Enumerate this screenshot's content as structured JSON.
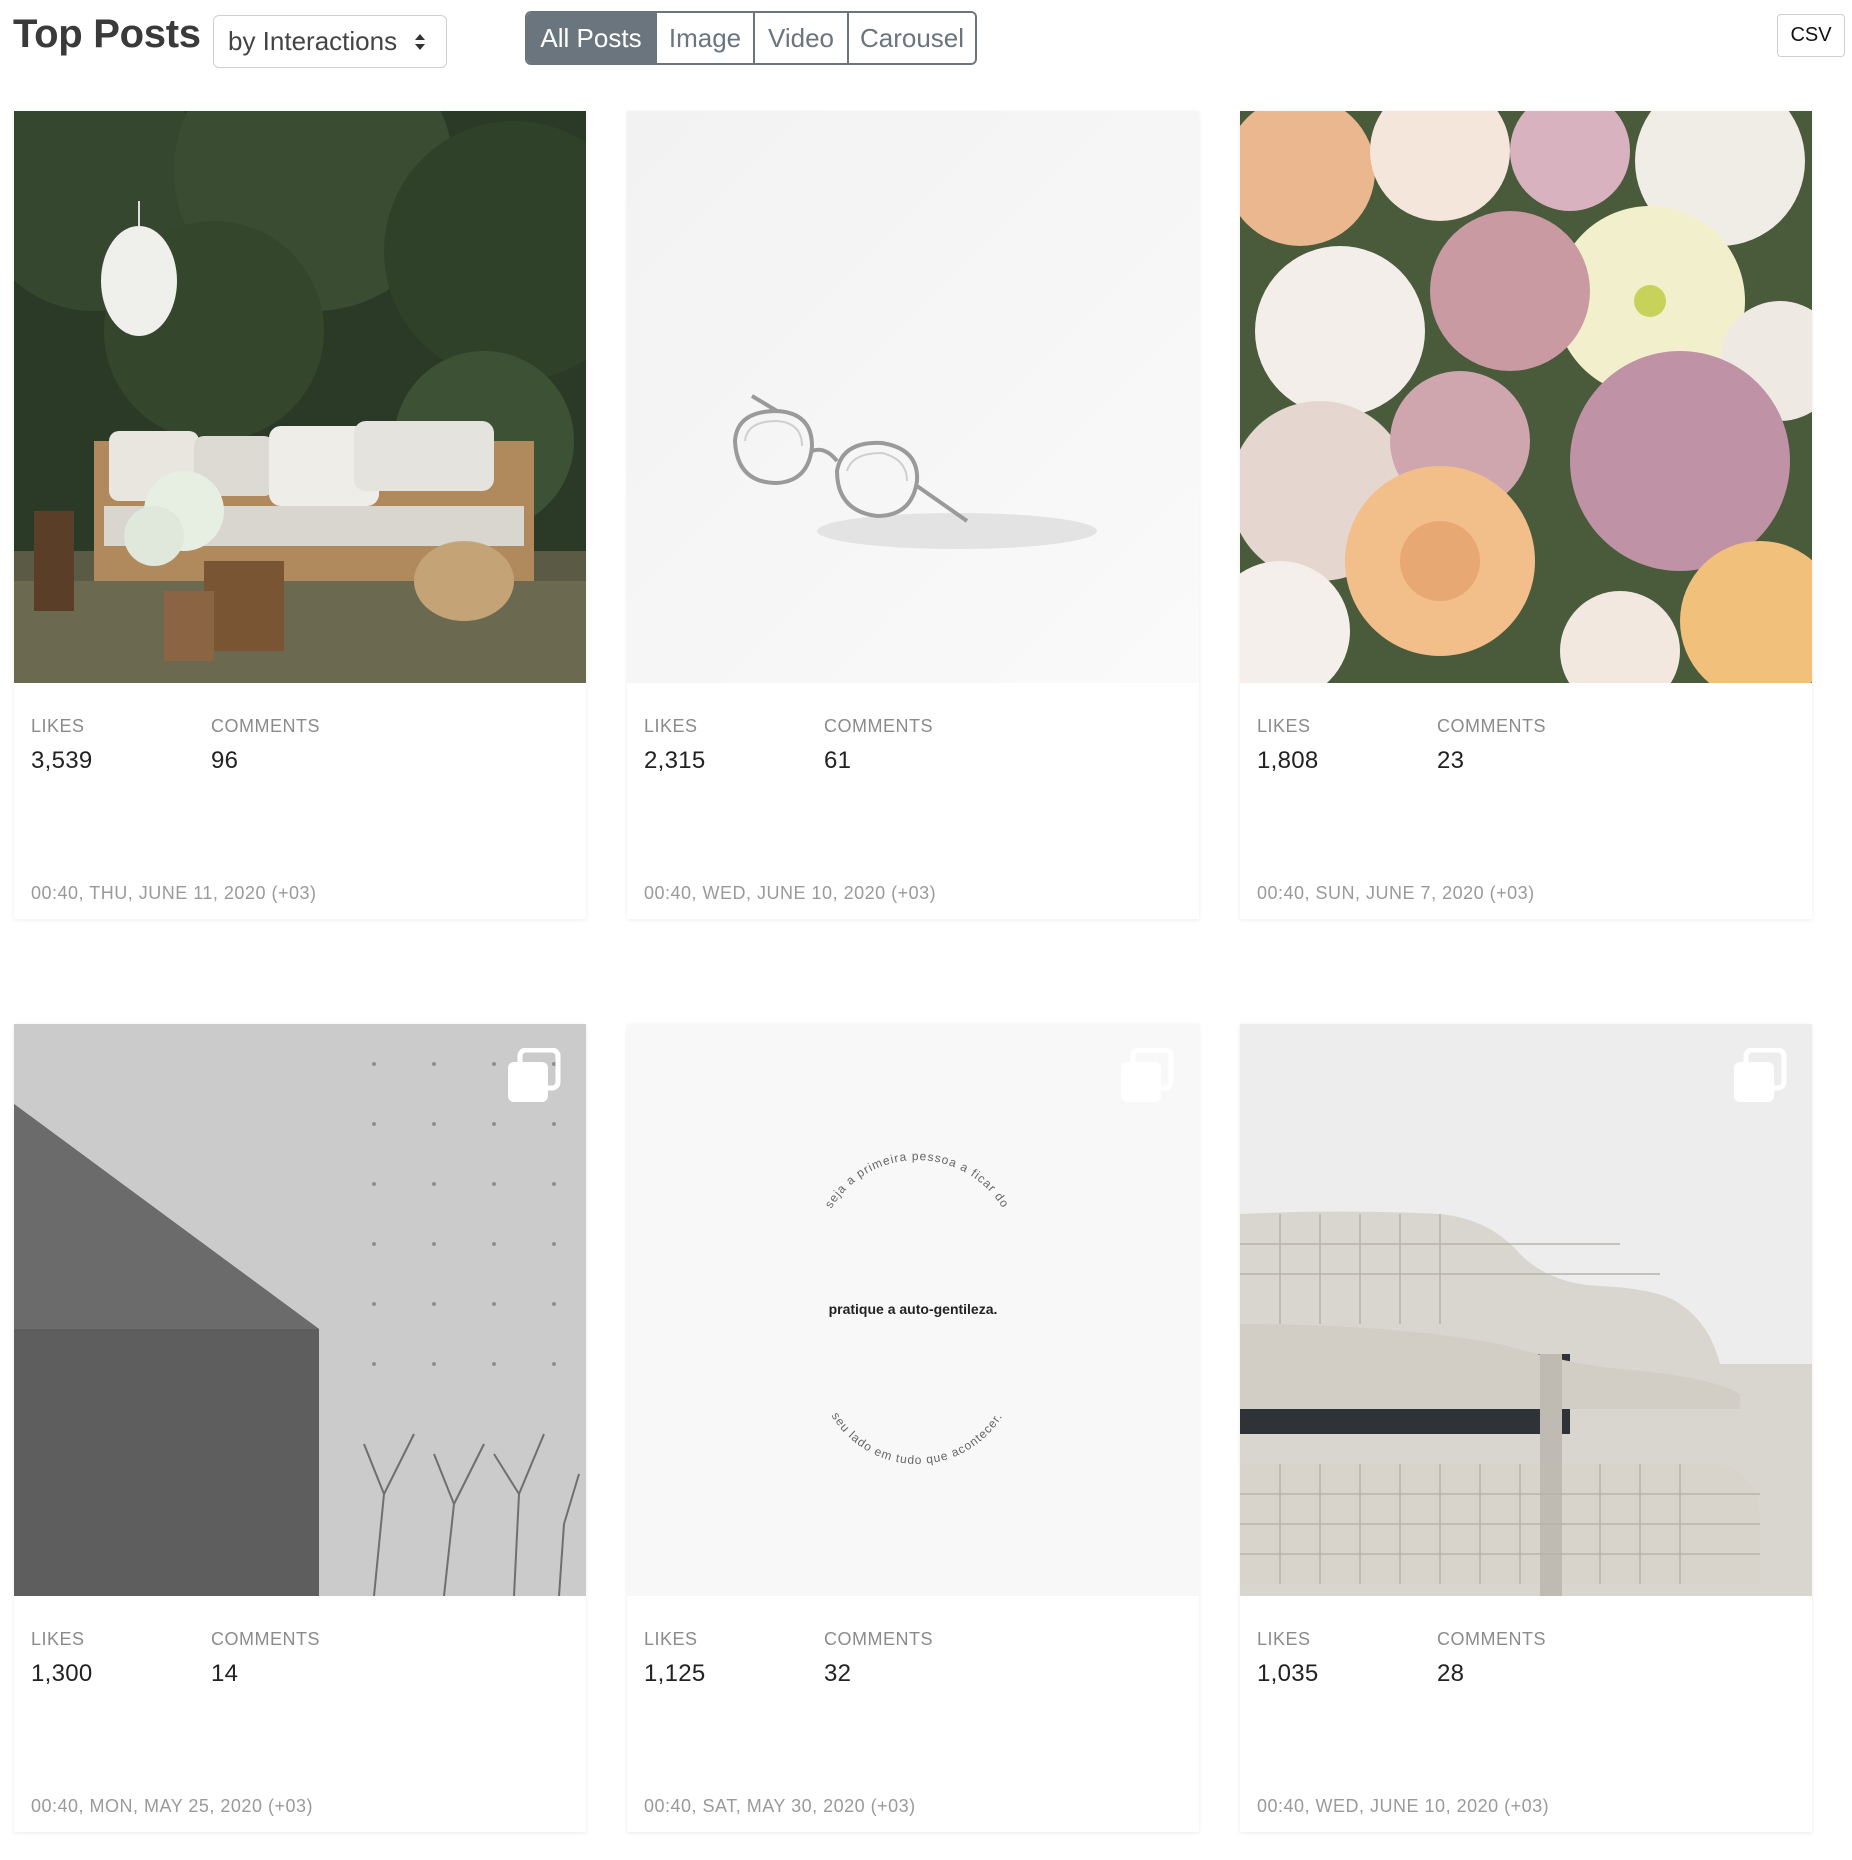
{
  "header": {
    "title": "Top Posts",
    "sort_value": "by Interactions",
    "filters": [
      "All Posts",
      "Image",
      "Video",
      "Carousel"
    ],
    "active_filter": "All Posts",
    "csv_label": "CSV"
  },
  "labels": {
    "likes": "LIKES",
    "comments": "COMMENTS"
  },
  "posts": [
    {
      "likes": "3,539",
      "comments": "96",
      "timestamp": "00:40, THU, JUNE 11, 2020 (+03)",
      "carousel": false,
      "image": "garden-bench-photo"
    },
    {
      "likes": "2,315",
      "comments": "61",
      "timestamp": "00:40, WED, JUNE 10, 2020 (+03)",
      "carousel": false,
      "image": "glasses-photo"
    },
    {
      "likes": "1,808",
      "comments": "23",
      "timestamp": "00:40, SUN, JUNE 7, 2020 (+03)",
      "carousel": false,
      "image": "flowers-photo"
    },
    {
      "likes": "1,300",
      "comments": "14",
      "timestamp": "00:40, MON, MAY 25, 2020 (+03)",
      "carousel": true,
      "image": "concrete-wall-photo"
    },
    {
      "likes": "1,125",
      "comments": "32",
      "timestamp": "00:40, SAT, MAY 30, 2020 (+03)",
      "carousel": true,
      "image": "quote-circle-graphic",
      "quote": {
        "top": "seja a primeira pessoa a ficar do",
        "middle": "pratique a auto-gentileza.",
        "bottom": "seu lado em tudo que acontecer."
      }
    },
    {
      "likes": "1,035",
      "comments": "28",
      "timestamp": "00:40, WED, JUNE 10, 2020 (+03)",
      "carousel": true,
      "image": "white-building-photo"
    }
  ],
  "colors": {
    "accent": "#6b757e",
    "muted": "#8b8b8b"
  }
}
